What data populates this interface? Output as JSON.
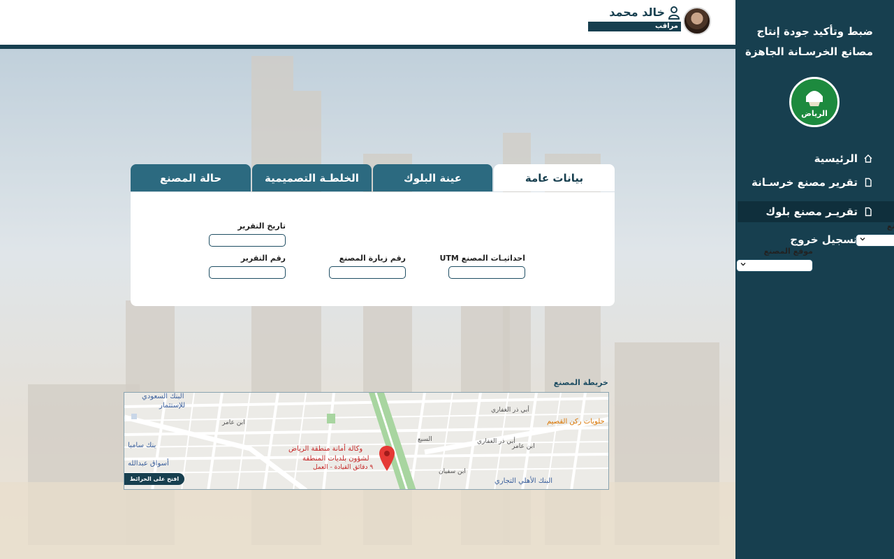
{
  "sidebar": {
    "title_line1": "ضبط وتأكيد جودة إنتاج",
    "title_line2": "مصانع الخرسـانة الجاهزة",
    "logo_text": "الرياض",
    "items": [
      {
        "label": "الرئيسية",
        "icon": "home-icon"
      },
      {
        "label": "تقرير مصنع خرسـانة",
        "icon": "document-icon"
      },
      {
        "label": "تقريـر مصنع بلوك",
        "icon": "document-icon",
        "active": true
      },
      {
        "label": "تسجيل خروج",
        "icon": "logout-icon"
      }
    ]
  },
  "header": {
    "user_name": "خالد محمد",
    "user_role": "مراقب"
  },
  "tabs": [
    {
      "label": "بيانات عامة",
      "active": true
    },
    {
      "label": "عينة البلوك",
      "active": false
    },
    {
      "label": "الخلطـة التصميمية",
      "active": false
    },
    {
      "label": "حالة المصنع",
      "active": false
    }
  ],
  "form": {
    "factory_name_label": "اسم المصنع",
    "factory_name_value": "",
    "factory_location_label": "موقع المصنع",
    "factory_location_value": "",
    "report_date_label": "تاريخ التقرير",
    "report_date_value": "",
    "utm_label": "احداثيـات المصنع UTM",
    "utm_value": "",
    "visit_number_label": "رقم زيارة المصنع",
    "visit_number_value": "",
    "report_number_label": "رقم التقرير",
    "report_number_value": ""
  },
  "map": {
    "title": "خريطة المصنع",
    "open_map_label": "افتح على الخرائط",
    "place_title": "وكالة أمانة منطقة الرياض",
    "place_subtitle": "لشؤون بلديات المنطقة",
    "place_eta": "٩ دقائق القيادة - العمل",
    "poi_bank_saudi": "البنك السعودي",
    "poi_bank_saudi2": "للإستثمار",
    "poi_bank_samba": "بنك سامبا",
    "poi_aswaq": "أسواق عبدالله",
    "poi_ahli": "البنك الأهلي التجاري",
    "poi_sweets": "حلويات ركن القصيم",
    "street_abu_dhar": "أبي ذر الغفاري",
    "street_abu_dhar2": "أبي ذر الغفاري",
    "street_abu_amer": "ابن عامر",
    "street_sabeer": "السبع",
    "street_amer2": "ابن عامر",
    "street_sofyan": "ابن سفيان"
  }
}
